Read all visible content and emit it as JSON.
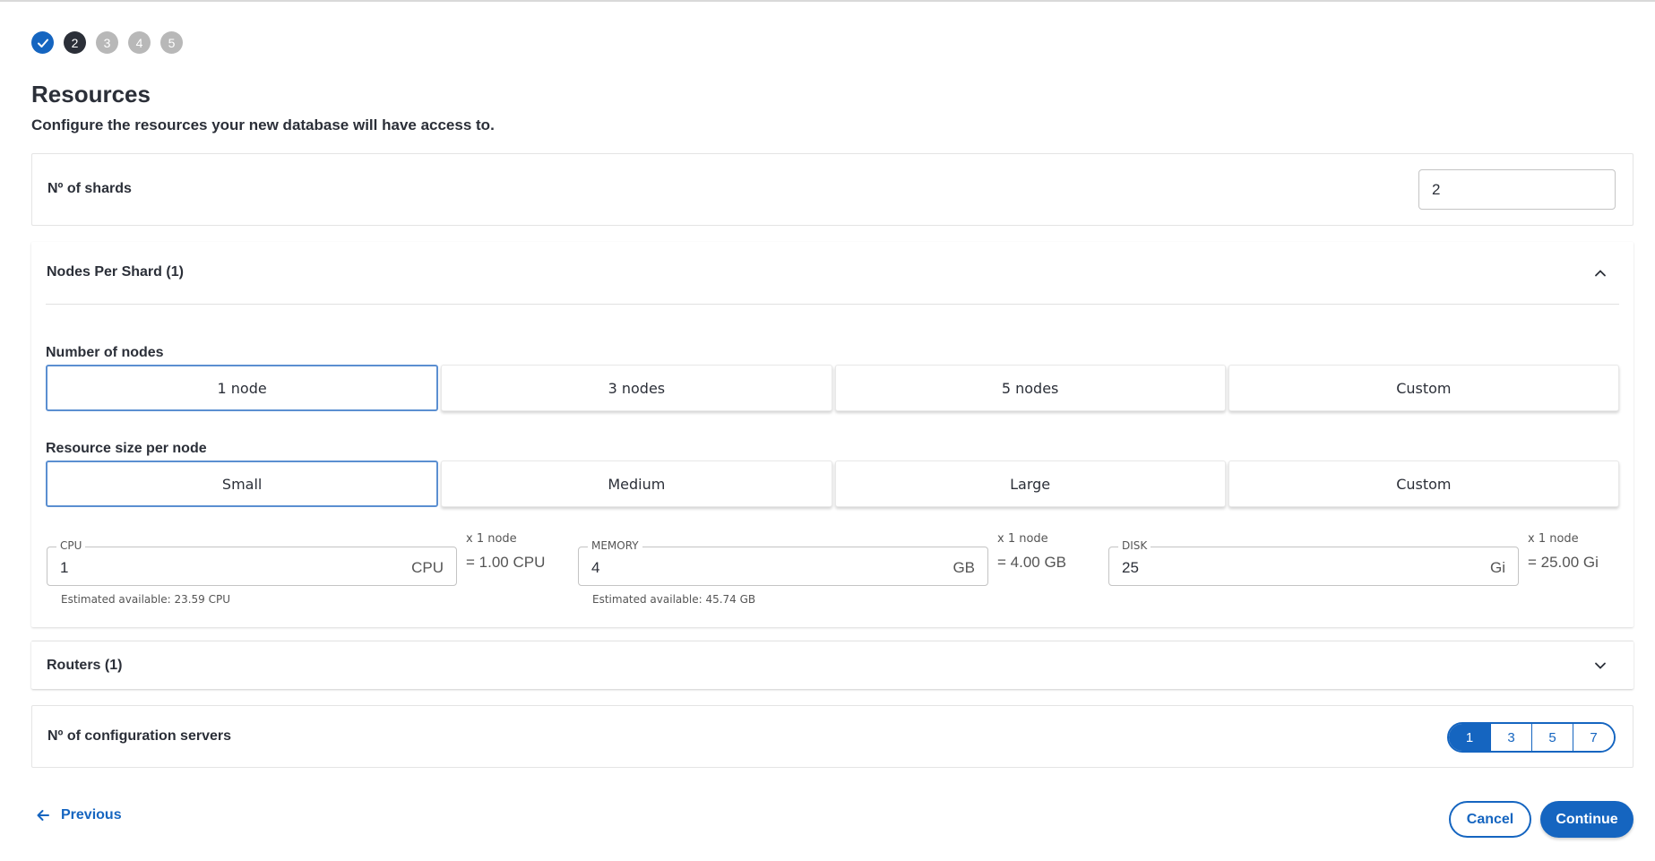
{
  "stepper": {
    "steps": [
      {
        "label": "",
        "state": "done"
      },
      {
        "label": "2",
        "state": "active"
      },
      {
        "label": "3",
        "state": "todo"
      },
      {
        "label": "4",
        "state": "todo"
      },
      {
        "label": "5",
        "state": "todo"
      }
    ]
  },
  "page": {
    "title": "Resources",
    "subtitle": "Configure the resources your new database will have access to."
  },
  "shards": {
    "label": "Nº of shards",
    "value": "2"
  },
  "nodes_per_shard": {
    "header": "Nodes Per Shard (1)",
    "expanded": true,
    "number_of_nodes": {
      "label": "Number of nodes",
      "options": [
        "1 node",
        "3 nodes",
        "5 nodes",
        "Custom"
      ],
      "selected": "1 node"
    },
    "resource_size": {
      "label": "Resource size per node",
      "options": [
        "Small",
        "Medium",
        "Large",
        "Custom"
      ],
      "selected": "Small"
    },
    "cpu": {
      "label": "CPU",
      "value": "1",
      "unit": "CPU",
      "multiplier": "x 1 node",
      "total": "= 1.00 CPU",
      "helper": "Estimated available: 23.59 CPU"
    },
    "memory": {
      "label": "MEMORY",
      "value": "4",
      "unit": "GB",
      "multiplier": "x 1 node",
      "total": "= 4.00 GB",
      "helper": "Estimated available: 45.74 GB"
    },
    "disk": {
      "label": "DISK",
      "value": "25",
      "unit": "Gi",
      "multiplier": "x 1 node",
      "total": "= 25.00 Gi"
    }
  },
  "routers": {
    "header": "Routers (1)",
    "expanded": false
  },
  "config_servers": {
    "label": "Nº of configuration servers",
    "options": [
      "1",
      "3",
      "5",
      "7"
    ],
    "selected": "1"
  },
  "footer": {
    "previous_label": "Previous",
    "cancel_label": "Cancel",
    "continue_label": "Continue"
  },
  "colors": {
    "primary": "#1565c0",
    "text": "#2b2f38",
    "step_todo": "#b8b8b8"
  }
}
